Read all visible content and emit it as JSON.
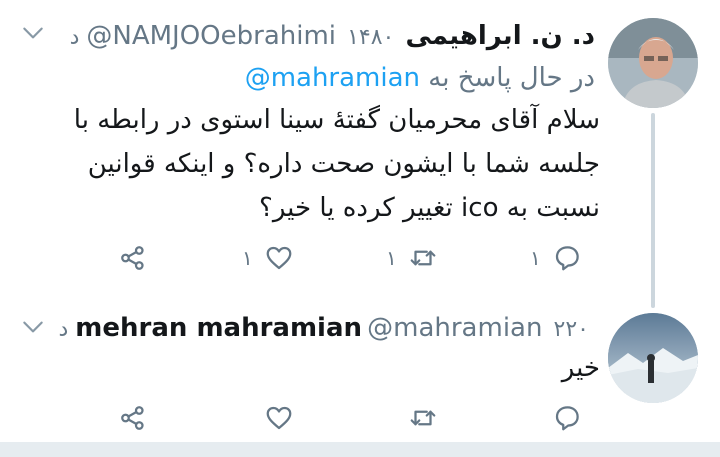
{
  "tweet1": {
    "display_name": "د. ن. ابراهیمی",
    "handle": "@NAMJOOebrahimi",
    "time": "۱۴۸۰ د",
    "reply_prefix": "در حال پاسخ به",
    "reply_to": "@mahramian",
    "text": "سلام آقای محرمیان گفتهٔ سینا استوی در رابطه با جلسه شما با ایشون صحت داره؟ و اینکه قوانین نسبت به ico تغییر کرده یا خیر؟",
    "reply_count": "۱",
    "retweet_count": "۱",
    "like_count": "۱"
  },
  "tweet2": {
    "display_name": "mehran mahramian",
    "handle": "@mahramian",
    "time": "۲۲۰ د",
    "text": "خیر"
  },
  "colors": {
    "name": "#14171a",
    "secondary": "#657786",
    "link": "#1da1f2",
    "thread_line": "#ccd6dd",
    "background": "#ffffff"
  }
}
